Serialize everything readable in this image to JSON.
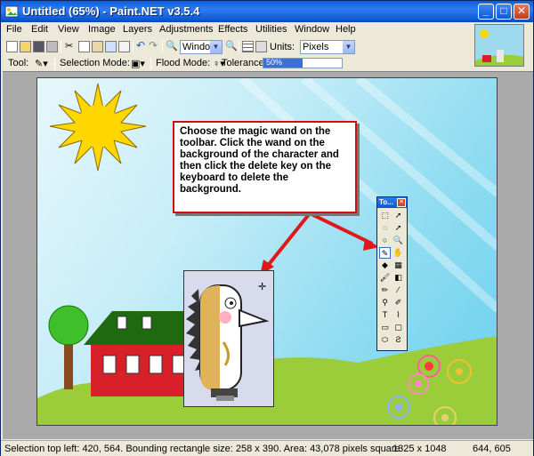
{
  "window": {
    "title": "Untitled (65%) - Paint.NET v3.5.4",
    "minimize": "_",
    "maximize": "□",
    "close": "✕"
  },
  "menu": [
    "File",
    "Edit",
    "View",
    "Image",
    "Layers",
    "Adjustments",
    "Effects",
    "Utilities",
    "Window",
    "Help"
  ],
  "toolbar": {
    "zoom_value": "Window",
    "units_label": "Units:",
    "units_value": "Pixels"
  },
  "tool_options": {
    "tool_label": "Tool:",
    "selection_mode_label": "Selection Mode:",
    "flood_mode_label": "Flood Mode:",
    "tolerance_label": "Tolerance:",
    "tolerance_value": "50%",
    "tolerance_fraction": 0.5
  },
  "callout": {
    "text": "Choose the magic wand on the toolbar. Click the wand on the background of the character and then click the delete key on the keyboard to delete the background."
  },
  "tools_window": {
    "title": "To...",
    "close": "✕"
  },
  "status": {
    "selection": "Selection top left: 420, 564. Bounding rectangle size: 258 x 390. Area: 43,078 pixels square",
    "image_size": "1325 x 1048",
    "cursor_position": "644, 605"
  },
  "colors": {
    "titlebar": "#0b57d0",
    "callout_border": "#cc1010",
    "arrow": "#e01818",
    "grass": "#9bcc3a",
    "sun": "#ffd700",
    "house_red": "#d8202a",
    "roof_green": "#1f6a10"
  }
}
